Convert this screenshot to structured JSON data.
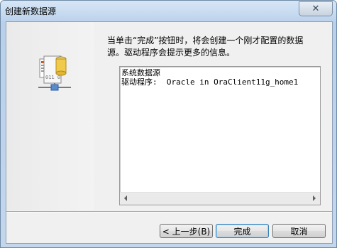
{
  "window": {
    "title": "创建新数据源",
    "close_label": "✕"
  },
  "content": {
    "instruction": "当单击“完成”按钮时，将会创建一个刚才配置的数据源。驱动程序会提示更多的信息。",
    "info_lines": [
      "系统数据源",
      "驱动程序:  Oracle in OraClient11g_home1"
    ]
  },
  "buttons": {
    "back": "< 上一步(B)",
    "finish": "完成",
    "cancel": "取消"
  },
  "icons": {
    "wizard": "database-source-icon",
    "close": "close-icon"
  }
}
